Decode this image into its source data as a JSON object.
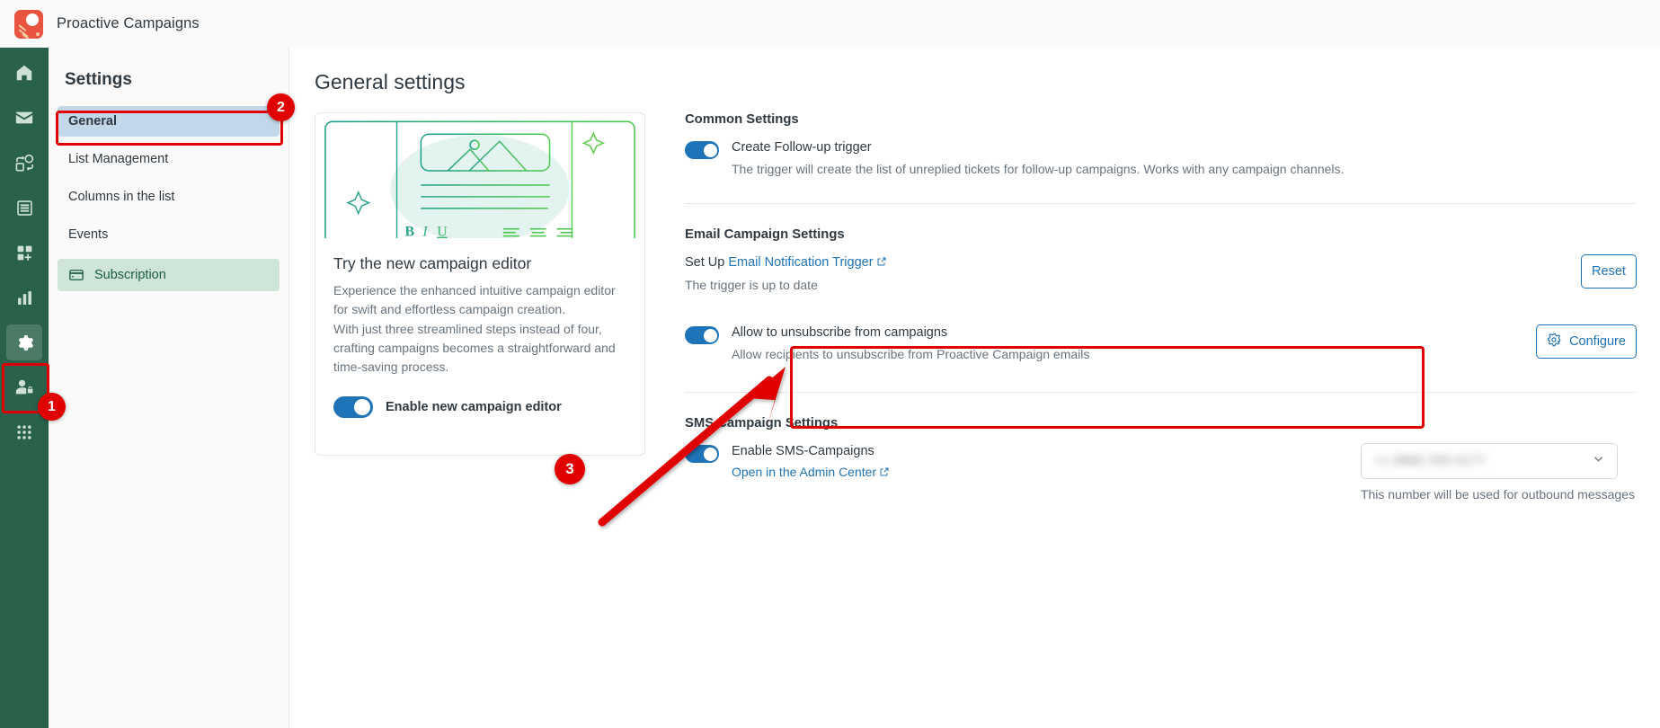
{
  "window": {
    "app_title": "Proactive Campaigns",
    "logo_icon": "proactive-campaigns-logo"
  },
  "rail": {
    "items": [
      {
        "icon": "home-icon",
        "name": "home"
      },
      {
        "icon": "mail-icon",
        "name": "mail"
      },
      {
        "icon": "automation-icon",
        "name": "automation"
      },
      {
        "icon": "database-icon",
        "name": "database"
      },
      {
        "icon": "add-apps-icon",
        "name": "add-apps"
      },
      {
        "icon": "chart-bar-icon",
        "name": "reporting"
      },
      {
        "icon": "gear-icon",
        "name": "settings"
      },
      {
        "icon": "user-lock-icon",
        "name": "admin"
      },
      {
        "icon": "grid-dots-icon",
        "name": "apps"
      }
    ],
    "active_index": 6
  },
  "settings_nav": {
    "title": "Settings",
    "items": [
      {
        "label": "General",
        "state": "selected",
        "icon": null
      },
      {
        "label": "List Management",
        "state": "normal",
        "icon": null
      },
      {
        "label": "Columns in the list",
        "state": "normal",
        "icon": null
      },
      {
        "label": "Events",
        "state": "normal",
        "icon": null
      },
      {
        "label": "Subscription",
        "state": "highlighted",
        "icon": "credit-card-icon"
      }
    ]
  },
  "main": {
    "page_title": "General settings"
  },
  "promo": {
    "illustration": "campaign-editor-illustration",
    "heading": "Try the new campaign editor",
    "paragraph": "Experience the enhanced intuitive campaign editor for swift and effortless campaign creation.\nWith just three streamlined steps instead of four, crafting campaigns becomes a straightforward and time-saving process.",
    "toggle_label": "Enable new campaign editor",
    "toggle_on": true
  },
  "common_settings": {
    "title": "Common Settings",
    "follow_up": {
      "label": "Create Follow-up trigger",
      "description": "The trigger will create the list of unreplied tickets for follow-up campaigns. Works with any campaign channels.",
      "toggle_on": true
    }
  },
  "email_settings": {
    "title": "Email Campaign Settings",
    "setup_prefix": "Set Up ",
    "setup_link": "Email Notification Trigger",
    "setup_link_icon": "external-link-icon",
    "status": "The trigger is up to date",
    "reset_button": "Reset",
    "unsubscribe": {
      "label": "Allow to unsubscribe from campaigns",
      "description": "Allow recipients to unsubscribe from Proactive Campaign emails",
      "toggle_on": true
    },
    "configure_button": "Configure",
    "configure_icon": "gear-icon"
  },
  "sms_settings": {
    "title": "SMS Campaign Settings",
    "enable": {
      "label": "Enable SMS-Campaigns",
      "link": "Open in the Admin Center",
      "link_icon": "external-link-icon",
      "toggle_on": true
    },
    "number_select": {
      "value": "+1 (888) 555-0177",
      "redacted": true,
      "chevron_icon": "chevron-down-icon"
    },
    "number_help": "This number will be used for outbound messages"
  },
  "annotations": {
    "accent_color": "#e00000",
    "badges": [
      {
        "number": "1",
        "target": "settings-rail-icon"
      },
      {
        "number": "2",
        "target": "general-nav-item"
      },
      {
        "number": "3",
        "target": "allow-unsubscribe-toggle"
      }
    ],
    "arrow_icon": "annotation-arrow"
  },
  "colors": {
    "rail_green": "#29614a",
    "toggle_blue": "#1f73b7",
    "link_blue": "#1f73b7",
    "selected_nav": "#c2d7e8",
    "subscription_nav": "#cfe5d7",
    "annotation_red": "#e00000"
  }
}
